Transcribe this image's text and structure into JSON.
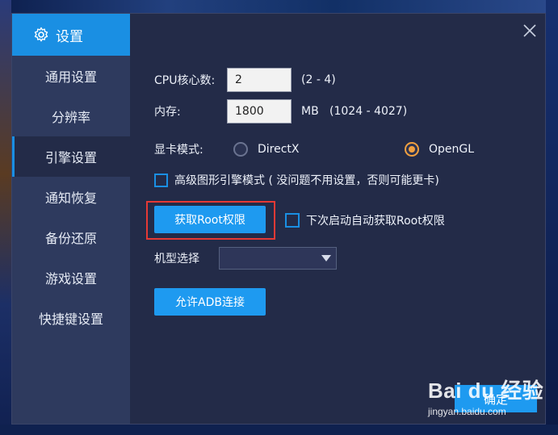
{
  "sidebar": {
    "header": "设置",
    "items": [
      {
        "label": "通用设置"
      },
      {
        "label": "分辨率"
      },
      {
        "label": "引擎设置"
      },
      {
        "label": "通知恢复"
      },
      {
        "label": "备份还原"
      },
      {
        "label": "游戏设置"
      },
      {
        "label": "快捷键设置"
      }
    ],
    "active_index": 2
  },
  "engine": {
    "cpu_label": "CPU核心数:",
    "cpu_value": "2",
    "cpu_range": "(2 - 4)",
    "mem_label": "内存:",
    "mem_value": "1800",
    "mem_range": "MB   (1024 - 4027)",
    "gpu_label": "显卡模式:",
    "gpu_options": [
      "DirectX",
      "OpenGL"
    ],
    "gpu_selected": "OpenGL",
    "advanced_label": "高级图形引擎模式 ( 没问题不用设置，否则可能更卡)",
    "root_button": "获取Root权限",
    "auto_root_label": "下次启动自动获取Root权限",
    "model_label": "机型选择",
    "model_value": "",
    "adb_button": "允许ADB连接",
    "confirm_button": "确定"
  },
  "watermark": {
    "logo": "Bai du 经验",
    "url": "jingyan.baidu.com"
  },
  "colors": {
    "accent": "#1e9af0",
    "highlight_box": "#e53935",
    "radio_checked": "#f0a040"
  }
}
